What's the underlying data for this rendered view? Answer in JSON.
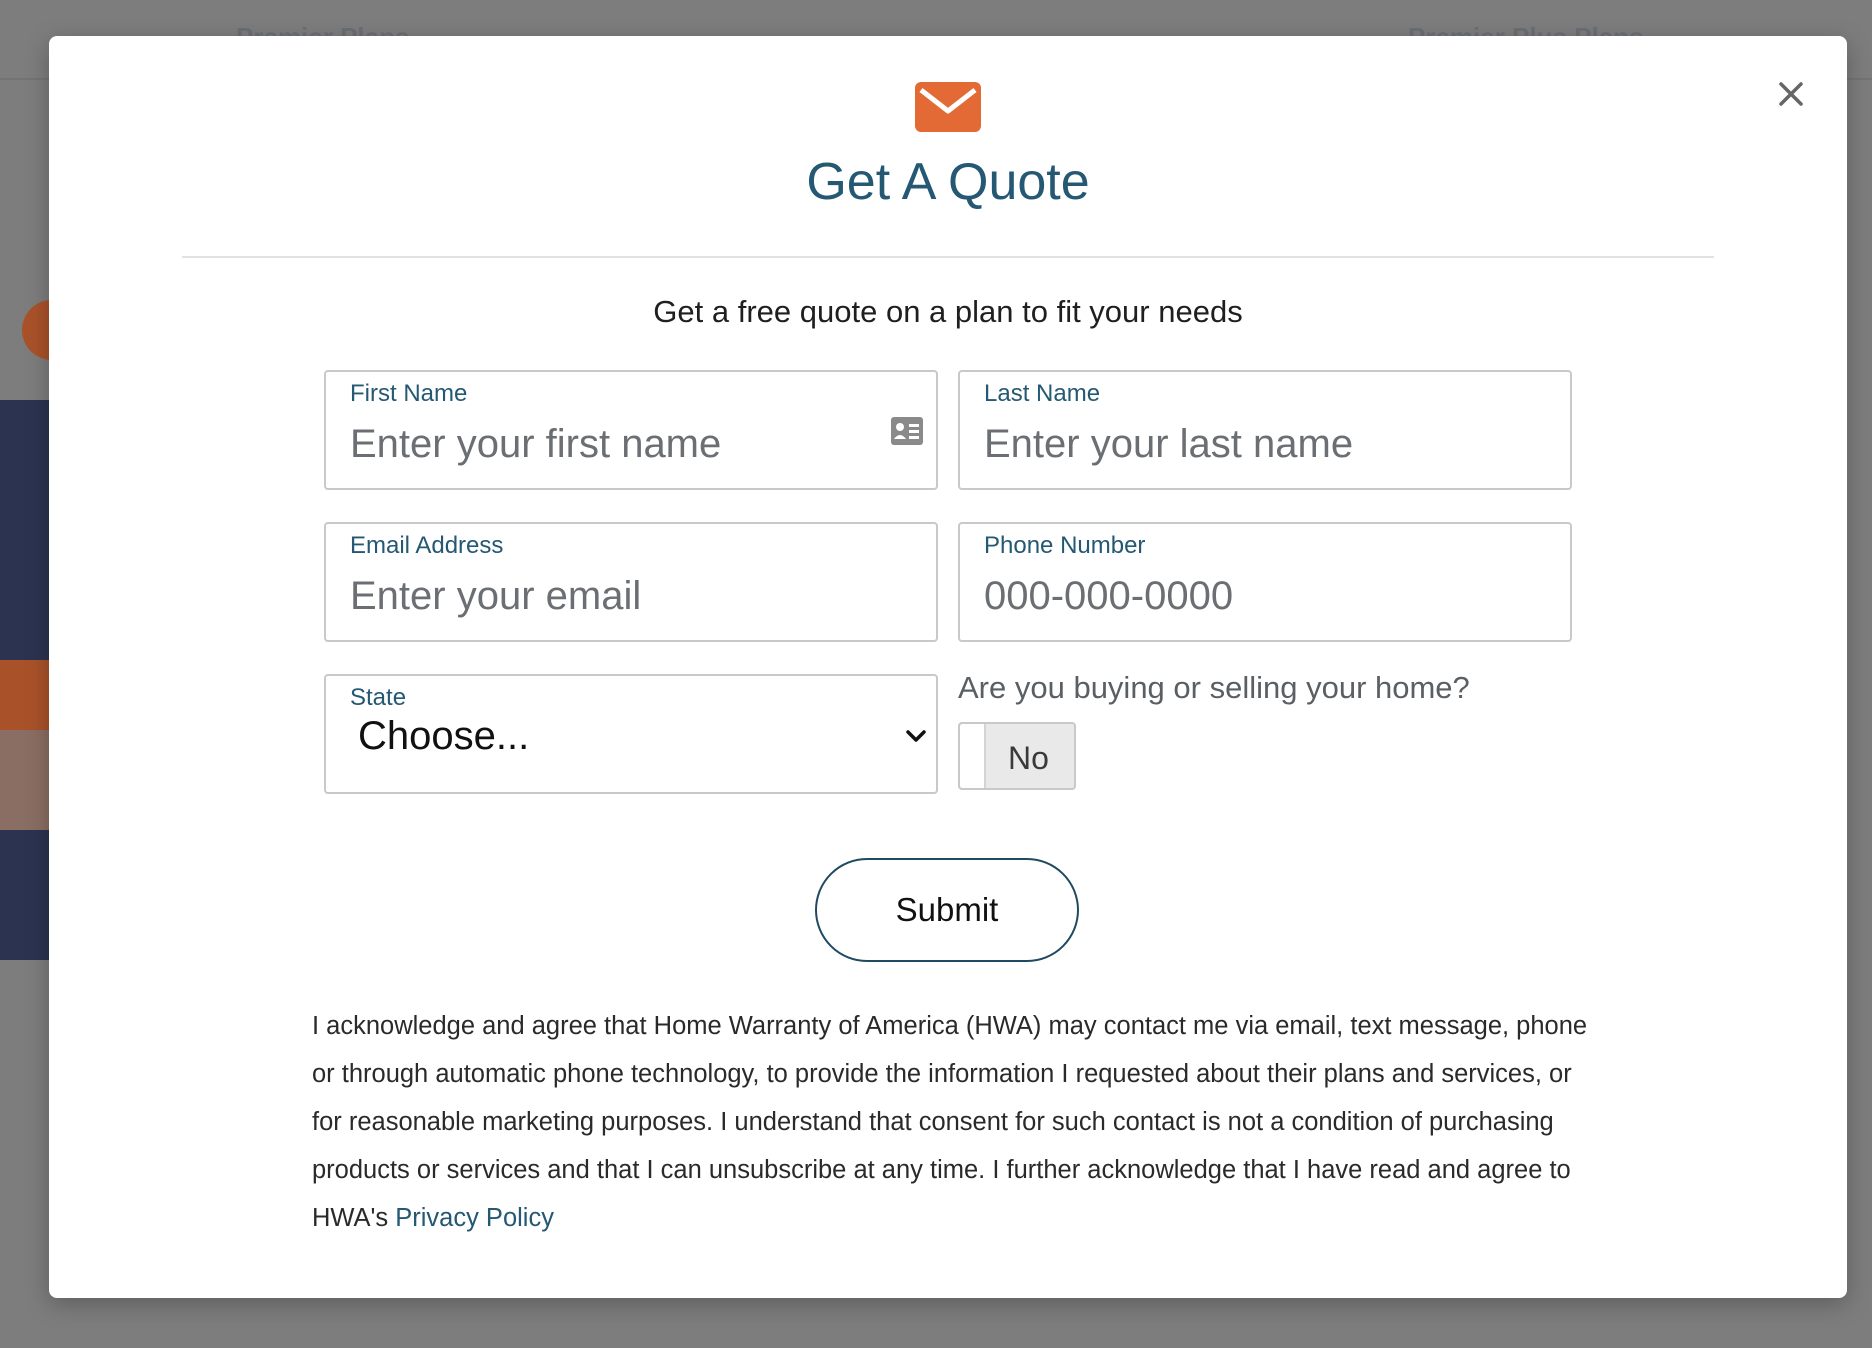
{
  "background": {
    "nav_left": "Premier Plans",
    "nav_right": "Premier Plus Plans"
  },
  "modal": {
    "title": "Get A Quote",
    "subtitle": "Get a free quote on a plan to fit your needs",
    "close_icon": "close-icon",
    "header_icon": "envelope-icon",
    "accent_color": "#e46a35",
    "title_color": "#245873"
  },
  "form": {
    "first_name": {
      "label": "First Name",
      "placeholder": "Enter your first name",
      "value": ""
    },
    "last_name": {
      "label": "Last Name",
      "placeholder": "Enter your last name",
      "value": ""
    },
    "email": {
      "label": "Email Address",
      "placeholder": "Enter your email",
      "value": ""
    },
    "phone": {
      "label": "Phone Number",
      "placeholder": "000-000-0000",
      "value": ""
    },
    "state": {
      "label": "State",
      "selected": "Choose..."
    },
    "buying_selling": {
      "question": "Are you buying or selling your home?",
      "toggle_label": "No"
    },
    "submit_label": "Submit"
  },
  "consent": {
    "text": "I acknowledge and agree that Home Warranty of America (HWA) may contact me via email, text message, phone or through automatic phone technology, to provide the information I requested about their plans and services, or for reasonable marketing purposes. I understand that consent for such contact is not a condition of purchasing products or services and that I can unsubscribe at any time. I further acknowledge that I have read and agree to HWA's ",
    "link_text": "Privacy Policy"
  }
}
